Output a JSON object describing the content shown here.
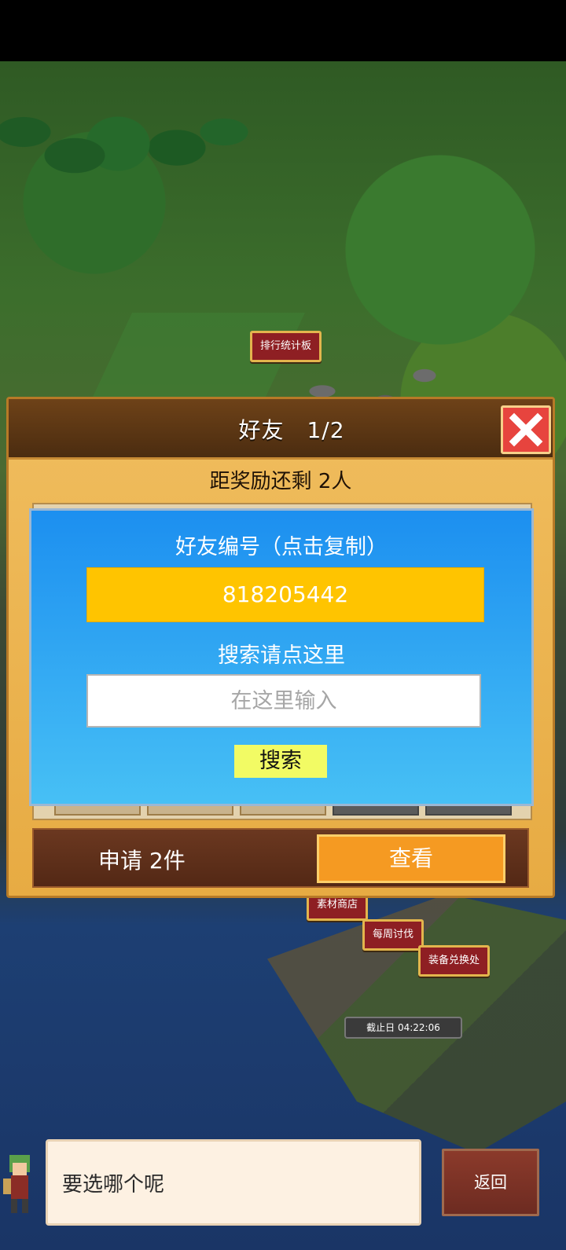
{
  "map": {
    "signs": {
      "ranking": "排行统计板",
      "material_shop": "素材商店",
      "weekly_hunt": "每周讨伐",
      "equipment_exchange": "装备兑换处"
    },
    "deadline": "截止日 04:22:06"
  },
  "dialog": {
    "title": "好友　1/2",
    "reward_text": "距奖励还剩 2人",
    "id_label": "好友编号（点击复制）",
    "friend_id": "818205442",
    "search_label": "搜索请点这里",
    "search_placeholder": "在这里输入",
    "search_button": "搜索",
    "request_text": "申请 2件",
    "view_button": "查看"
  },
  "chat": {
    "message": "要选哪个呢",
    "back_button": "返回"
  },
  "colors": {
    "panel_blue": "#1c8ff0",
    "id_yellow": "#ffc400",
    "close_red": "#e7443e",
    "view_orange": "#f59a22"
  }
}
